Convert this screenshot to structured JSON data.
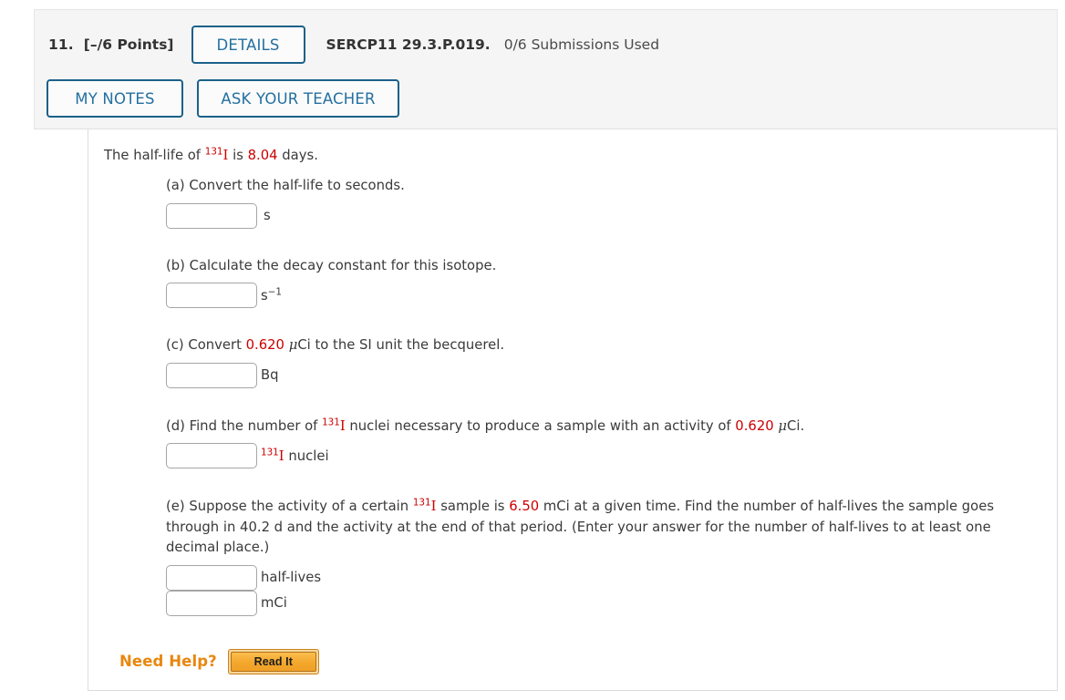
{
  "header": {
    "question_number": "11.",
    "points": "[–/6 Points]",
    "details_label": "DETAILS",
    "question_code": "SERCP11 29.3.P.019.",
    "submissions": "0/6 Submissions Used",
    "my_notes_label": "MY NOTES",
    "ask_teacher_label": "ASK YOUR TEACHER"
  },
  "colors": {
    "button_border": "#1b6189",
    "button_text": "#2470a0",
    "panel_bg": "#f5f5f5",
    "value_red": "#cc0000",
    "need_help_orange": "#e8870f"
  },
  "problem": {
    "stem": {
      "before": "The half-life of ",
      "isotope_mass": "131",
      "isotope_symbol": "I",
      "middle": " is ",
      "value": "8.04",
      "after": " days."
    },
    "parts": [
      {
        "id": "a",
        "label": "(a) Convert the half-life to seconds.",
        "inputs": [
          {
            "value": "",
            "unit": "s"
          }
        ]
      },
      {
        "id": "b",
        "label": "(b) Calculate the decay constant for this isotope.",
        "inputs": [
          {
            "value": "",
            "unit_base": "s",
            "unit_sup": "−1"
          }
        ]
      },
      {
        "id": "c",
        "label_before": "(c) Convert ",
        "label_value": "0.620",
        "label_mu": "μ",
        "label_after": "Ci to the SI unit the becquerel.",
        "inputs": [
          {
            "value": "",
            "unit": "Bq"
          }
        ]
      },
      {
        "id": "d",
        "label_before": "(d) Find the number of ",
        "isotope_mass": "131",
        "isotope_symbol": "I",
        "label_middle": " nuclei necessary to produce a sample with an activity of ",
        "label_value": "0.620",
        "label_mu": "μ",
        "label_after": "Ci.",
        "inputs": [
          {
            "value": "",
            "unit_isotope_mass": "131",
            "unit_isotope_symbol": "I",
            "unit_after": " nuclei"
          }
        ]
      },
      {
        "id": "e",
        "label_before": "(e) Suppose the activity of a certain ",
        "isotope_mass": "131",
        "isotope_symbol": "I",
        "label_middle": " sample is ",
        "label_value": "6.50",
        "label_after": " mCi at a given time. Find the number of half-lives the sample goes through in 40.2 d and the activity at the end of that period. (Enter your answer for the number of half-lives to at least one decimal place.)",
        "inputs": [
          {
            "value": "",
            "unit": "half-lives"
          },
          {
            "value": "",
            "unit": "mCi"
          }
        ]
      }
    ]
  },
  "need_help": {
    "label": "Need Help?",
    "read_it_label": "Read It"
  }
}
